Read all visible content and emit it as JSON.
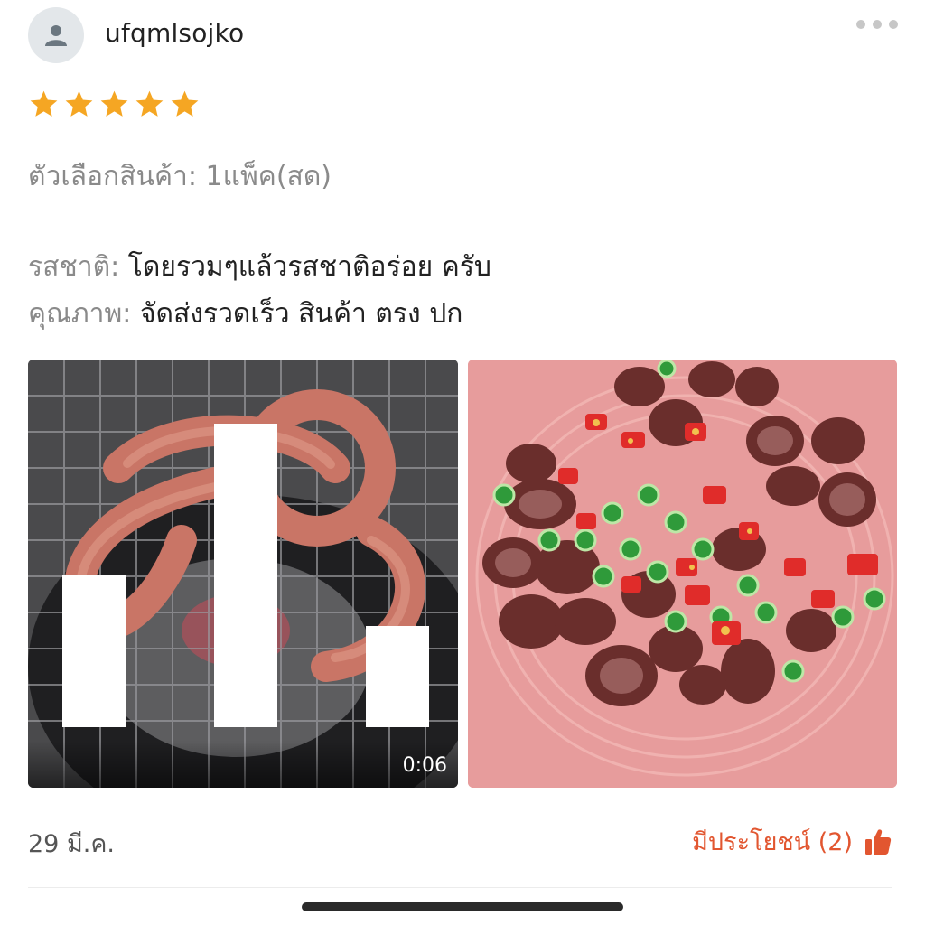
{
  "review": {
    "username": "ufqmlsojko",
    "rating": 5,
    "variant_label": "ตัวเลือกสินค้า:",
    "variant_value": "1แพ็ค(สด)",
    "taste_label": "รสชาติ:",
    "taste_value": "โดยรวมๆแล้วรสชาติอร่อย ครับ",
    "quality_label": "คุณภาพ:",
    "quality_value": "จัดส่งรวดเร็ว  สินค้า ตรง ปก",
    "date": "29 มี.ค.",
    "helpful_label": "มีประโยชน์ (2)"
  },
  "media": {
    "video": {
      "duration": "0:06",
      "icon": "video-bars-icon"
    },
    "photo": {
      "icon": "photo"
    }
  },
  "icons": {
    "avatar": "user-icon",
    "more": "more-horizontal-icon",
    "star": "star-icon",
    "helpful": "thumbs-up-icon"
  },
  "colors": {
    "star": "#f5a623",
    "accent": "#e25630",
    "label": "#8a8a8a",
    "text": "#222222"
  }
}
